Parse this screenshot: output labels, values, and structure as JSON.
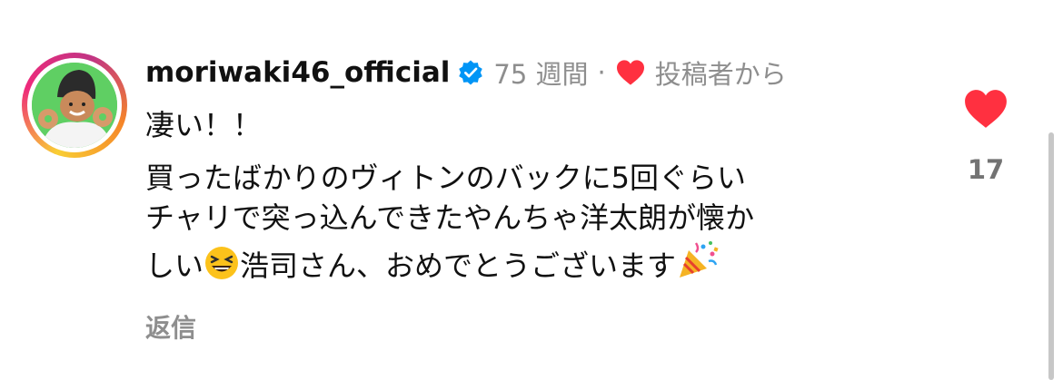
{
  "comment": {
    "username": "moriwaki46_official",
    "timestamp": "75 週間",
    "separator": "·",
    "author_liked": "投稿者から",
    "lines": [
      "凄い！！",
      "買ったばかりのヴィトンのバックに5回ぐらい",
      "チャリで突っ込んできたやんちゃ洋太朗が懐か",
      "しい",
      "浩司さん、おめでとうございます"
    ],
    "emojis": [
      "laughing-face",
      "party-popper"
    ],
    "reply_label": "返信",
    "like_count": "17"
  },
  "colors": {
    "heart": "#ff3040",
    "verified": "#0095f6",
    "secondary_text": "#8e8e8e"
  }
}
